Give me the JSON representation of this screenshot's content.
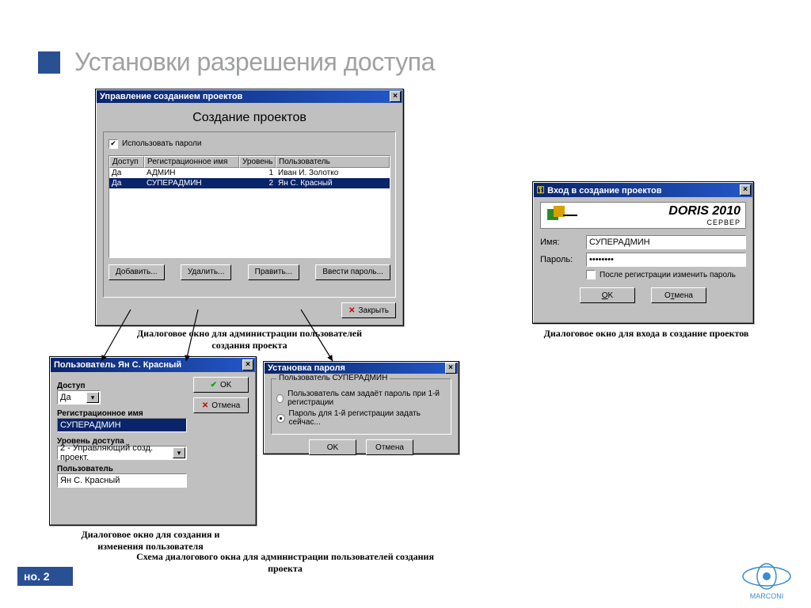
{
  "slide": {
    "title": "Установки разрешения доступа",
    "page_label": "но. 2",
    "logo_text": "MARCONI"
  },
  "admin_dlg": {
    "title": "Управление созданием проектов",
    "heading": "Создание проектов",
    "use_passwords": "Использовать пароли",
    "cols": {
      "access": "Доступ",
      "regname": "Регистрационное имя",
      "level": "Уровень",
      "user": "Пользователь"
    },
    "rows": [
      {
        "access": "Да",
        "regname": "АДМИН",
        "level": "1",
        "user": "Иван И. Золотко"
      },
      {
        "access": "Да",
        "regname": "СУПЕРАДМИН",
        "level": "2",
        "user": "Ян С. Красный"
      }
    ],
    "btn_add": "Добавить...",
    "btn_del": "Удалить...",
    "btn_edit": "Править...",
    "btn_pwd": "Ввести пароль...",
    "btn_close": "Закрыть",
    "caption": "Диалоговое окно для администрации пользователей создания проекта"
  },
  "user_dlg": {
    "title": "Пользователь Ян С. Красный",
    "lbl_access": "Доступ",
    "val_access": "Да",
    "lbl_regname": "Регистрационное имя",
    "val_regname": "СУПЕРАДМИН",
    "lbl_level": "Уровень доступа",
    "val_level": "2 - Управляющий созд. проект.",
    "lbl_user": "Пользователь",
    "val_user": "Ян С. Красный",
    "btn_ok": "OK",
    "btn_cancel": "Отмена",
    "caption": "Диалоговое окно для создания и изменения пользователя"
  },
  "pwd_dlg": {
    "title": "Установка пароля",
    "group": "Пользователь СУПЕРАДМИН",
    "opt1": "Пользователь сам задаёт пароль при 1-й регистрации",
    "opt2": "Пароль для 1-й регистрации задать сейчас...",
    "btn_ok": "OK",
    "btn_cancel": "Отмена"
  },
  "login_dlg": {
    "title": "Вход в создание проектов",
    "brand": "DORIS 2010",
    "brand_sub": "СЕРВЕР",
    "lbl_name": "Имя:",
    "val_name": "СУПЕРАДМИН",
    "lbl_pass": "Пароль:",
    "val_pass": "••••••••",
    "chk_change": "После регистрации изменить пароль",
    "btn_ok": "OK",
    "btn_cancel": "Отмена",
    "caption": "Диалоговое окно для входа в создание проектов"
  },
  "scheme_caption": "Схема диалогового окна для администрации пользователей создания проекта"
}
